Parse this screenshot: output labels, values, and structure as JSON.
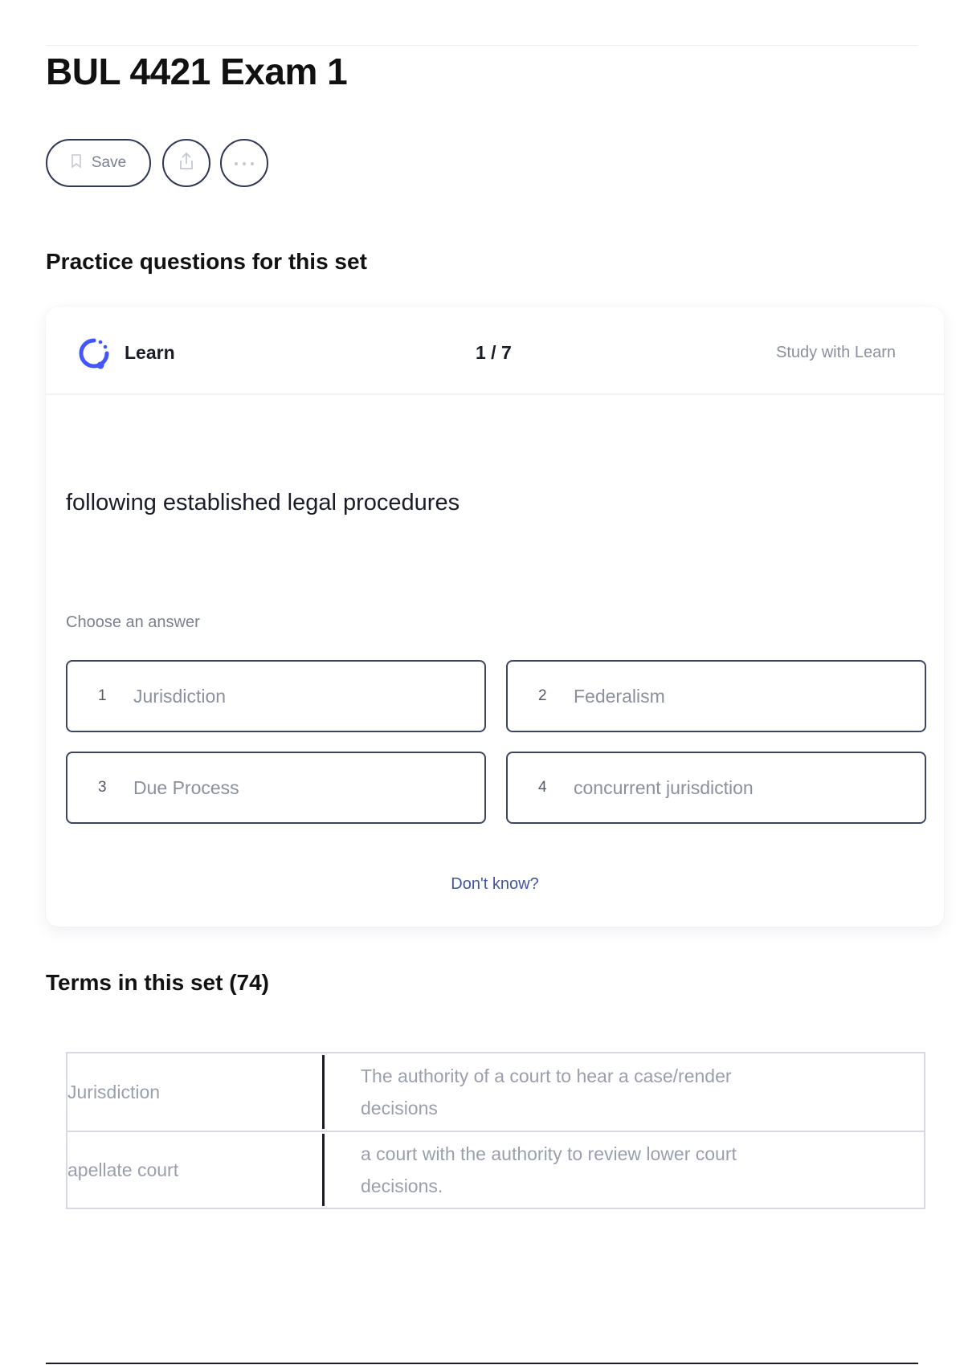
{
  "header": {
    "title": "BUL 4421 Exam 1",
    "save_label": "Save",
    "share_icon": "share-icon",
    "more_icon": "more-icon"
  },
  "practice": {
    "heading": "Practice questions for this set",
    "mode_label": "Learn",
    "progress": "1 / 7",
    "study_link": "Study with Learn",
    "prompt": "following established legal procedures",
    "choose_label": "Choose an answer",
    "answers": [
      {
        "num": "1",
        "text": "Jurisdiction"
      },
      {
        "num": "2",
        "text": "Federalism"
      },
      {
        "num": "3",
        "text": "Due Process"
      },
      {
        "num": "4",
        "text": "concurrent jurisdiction"
      }
    ],
    "dont_know": "Don't know?",
    "accent_color": "#4255ff"
  },
  "terms": {
    "heading": "Terms in this set (74)",
    "rows": [
      {
        "term": "Jurisdiction",
        "definition": "The authority of a court to hear a case/render decisions"
      },
      {
        "term": "apellate court",
        "definition": "a court with the authority to review lower court decisions."
      }
    ]
  }
}
